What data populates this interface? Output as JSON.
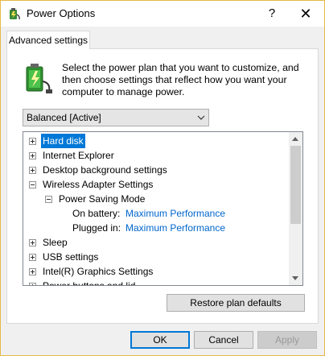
{
  "window": {
    "title": "Power Options",
    "help_glyph": "?",
    "close_glyph": "✕"
  },
  "tab": {
    "label": "Advanced settings"
  },
  "description": "Select the power plan that you want to customize, and then choose settings that reflect how you want your computer to manage power.",
  "plan_select": {
    "value": "Balanced [Active]"
  },
  "tree": {
    "hard_disk": "Hard disk",
    "internet_explorer": "Internet Explorer",
    "desktop_background": "Desktop background settings",
    "wireless_adapter": "Wireless Adapter Settings",
    "power_saving_mode": "Power Saving Mode",
    "on_battery_label": "On battery:",
    "on_battery_value": "Maximum Performance",
    "plugged_in_label": "Plugged in:",
    "plugged_in_value": "Maximum Performance",
    "sleep": "Sleep",
    "usb": "USB settings",
    "intel_graphics": "Intel(R) Graphics Settings",
    "power_buttons": "Power buttons and lid"
  },
  "buttons": {
    "restore": "Restore plan defaults",
    "ok": "OK",
    "cancel": "Cancel",
    "apply": "Apply"
  },
  "colors": {
    "selection": "#0078d7",
    "link_value": "#0066cc",
    "frame": "#e8b84a"
  }
}
